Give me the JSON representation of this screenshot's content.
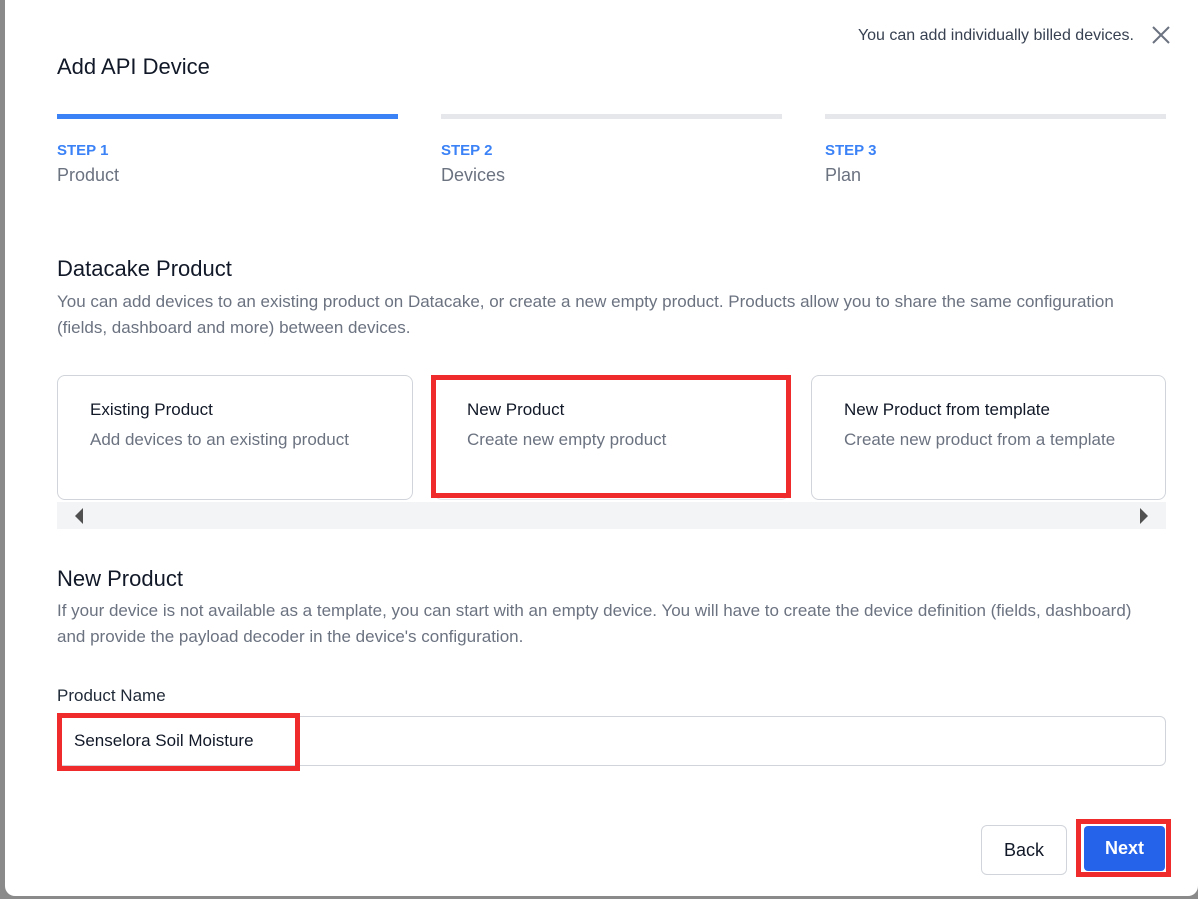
{
  "modal": {
    "title": "Add API Device",
    "billing_note": "You can add individually billed devices.",
    "close_icon": "close-icon"
  },
  "steps": [
    {
      "number": "STEP 1",
      "name": "Product",
      "active": true
    },
    {
      "number": "STEP 2",
      "name": "Devices",
      "active": false
    },
    {
      "number": "STEP 3",
      "name": "Plan",
      "active": false
    }
  ],
  "product_section": {
    "heading": "Datacake Product",
    "description": "You can add devices to an existing product on Datacake, or create a new empty product. Products allow you to share the same configuration (fields, dashboard and more) between devices.",
    "options": [
      {
        "title": "Existing Product",
        "subtitle": "Add devices to an existing product"
      },
      {
        "title": "New Product",
        "subtitle": "Create new empty product",
        "selected": true
      },
      {
        "title": "New Product from template",
        "subtitle": "Create new product from a template"
      }
    ]
  },
  "new_product_section": {
    "heading": "New Product",
    "description": "If your device is not available as a template, you can start with an empty device. You will have to create the device definition (fields, dashboard) and provide the payload decoder in the device's configuration.",
    "field_label": "Product Name",
    "field_value": "Senselora Soil Moisture"
  },
  "footer": {
    "back_label": "Back",
    "next_label": "Next"
  },
  "colors": {
    "accent": "#3b82f6",
    "primary_button": "#2563eb",
    "highlight": "#ef2b2b"
  }
}
